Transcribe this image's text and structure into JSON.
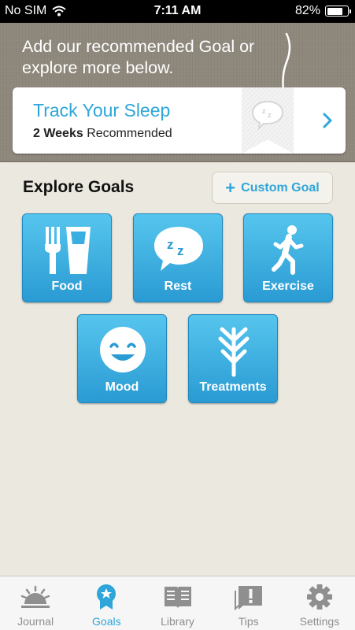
{
  "status_bar": {
    "carrier": "No SIM",
    "time": "7:11 AM",
    "battery": "82%",
    "battery_level": 0.82
  },
  "recommendation": {
    "prompt": "Add our recommended Goal or explore more below.",
    "goal_title": "Track Your Sleep",
    "duration": "2 Weeks",
    "duration_suffix": " Recommended"
  },
  "explore": {
    "title": "Explore Goals",
    "custom_goal_label": "Custom Goal",
    "categories": [
      {
        "label": "Food",
        "icon": "food-icon"
      },
      {
        "label": "Rest",
        "icon": "rest-icon"
      },
      {
        "label": "Exercise",
        "icon": "exercise-icon"
      },
      {
        "label": "Mood",
        "icon": "mood-icon"
      },
      {
        "label": "Treatments",
        "icon": "treatments-icon"
      }
    ]
  },
  "tab_bar": {
    "active": "Goals",
    "items": [
      {
        "label": "Journal",
        "icon": "journal-icon"
      },
      {
        "label": "Goals",
        "icon": "goals-icon"
      },
      {
        "label": "Library",
        "icon": "library-icon"
      },
      {
        "label": "Tips",
        "icon": "tips-icon"
      },
      {
        "label": "Settings",
        "icon": "settings-icon"
      }
    ]
  },
  "colors": {
    "accent": "#2ea6d9",
    "tile_top": "#56c5ee",
    "tile_bottom": "#2a9bd3",
    "banner": "#8e877c"
  }
}
